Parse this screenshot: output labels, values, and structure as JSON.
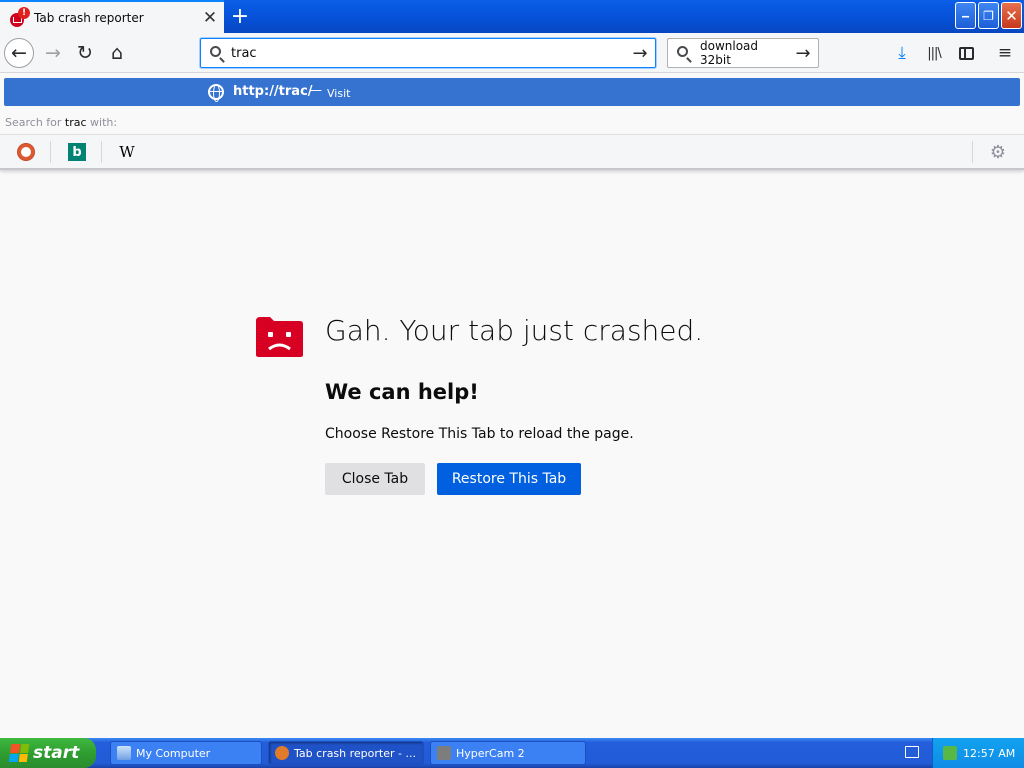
{
  "tab": {
    "title": "Tab crash reporter",
    "badge": "!",
    "close": "✕"
  },
  "newtab": "+",
  "window": {
    "minimize": "‒",
    "restore": "❐",
    "close": "✕"
  },
  "nav": {
    "back": "←",
    "forward": "→",
    "reload": "↻",
    "home": "⌂",
    "url_value": "trac",
    "go": "→",
    "search_value": "download 32bit",
    "search_go": "→",
    "download": "⤓",
    "library": "|||\\",
    "menu": "≡"
  },
  "popup": {
    "suggestion_url": "http://trac/",
    "suggestion_sep": "—",
    "suggestion_action": "Visit",
    "search_for_prefix": "Search for",
    "search_for_term": "trac",
    "search_for_suffix": "with:",
    "engines": {
      "bing": "b",
      "wikipedia": "W"
    },
    "settings": "⚙"
  },
  "crash": {
    "title": "Gah. Your tab just crashed.",
    "subtitle": "We can help!",
    "message": "Choose Restore This Tab to reload the page.",
    "close_label": "Close Tab",
    "restore_label": "Restore This Tab"
  },
  "taskbar": {
    "start": "start",
    "tasks": [
      "My Computer",
      "Tab crash reporter - ...",
      "HyperCam 2"
    ],
    "clock": "12:57 AM"
  },
  "colors": {
    "accent": "#0060df",
    "crash_icon": "#d70022"
  }
}
